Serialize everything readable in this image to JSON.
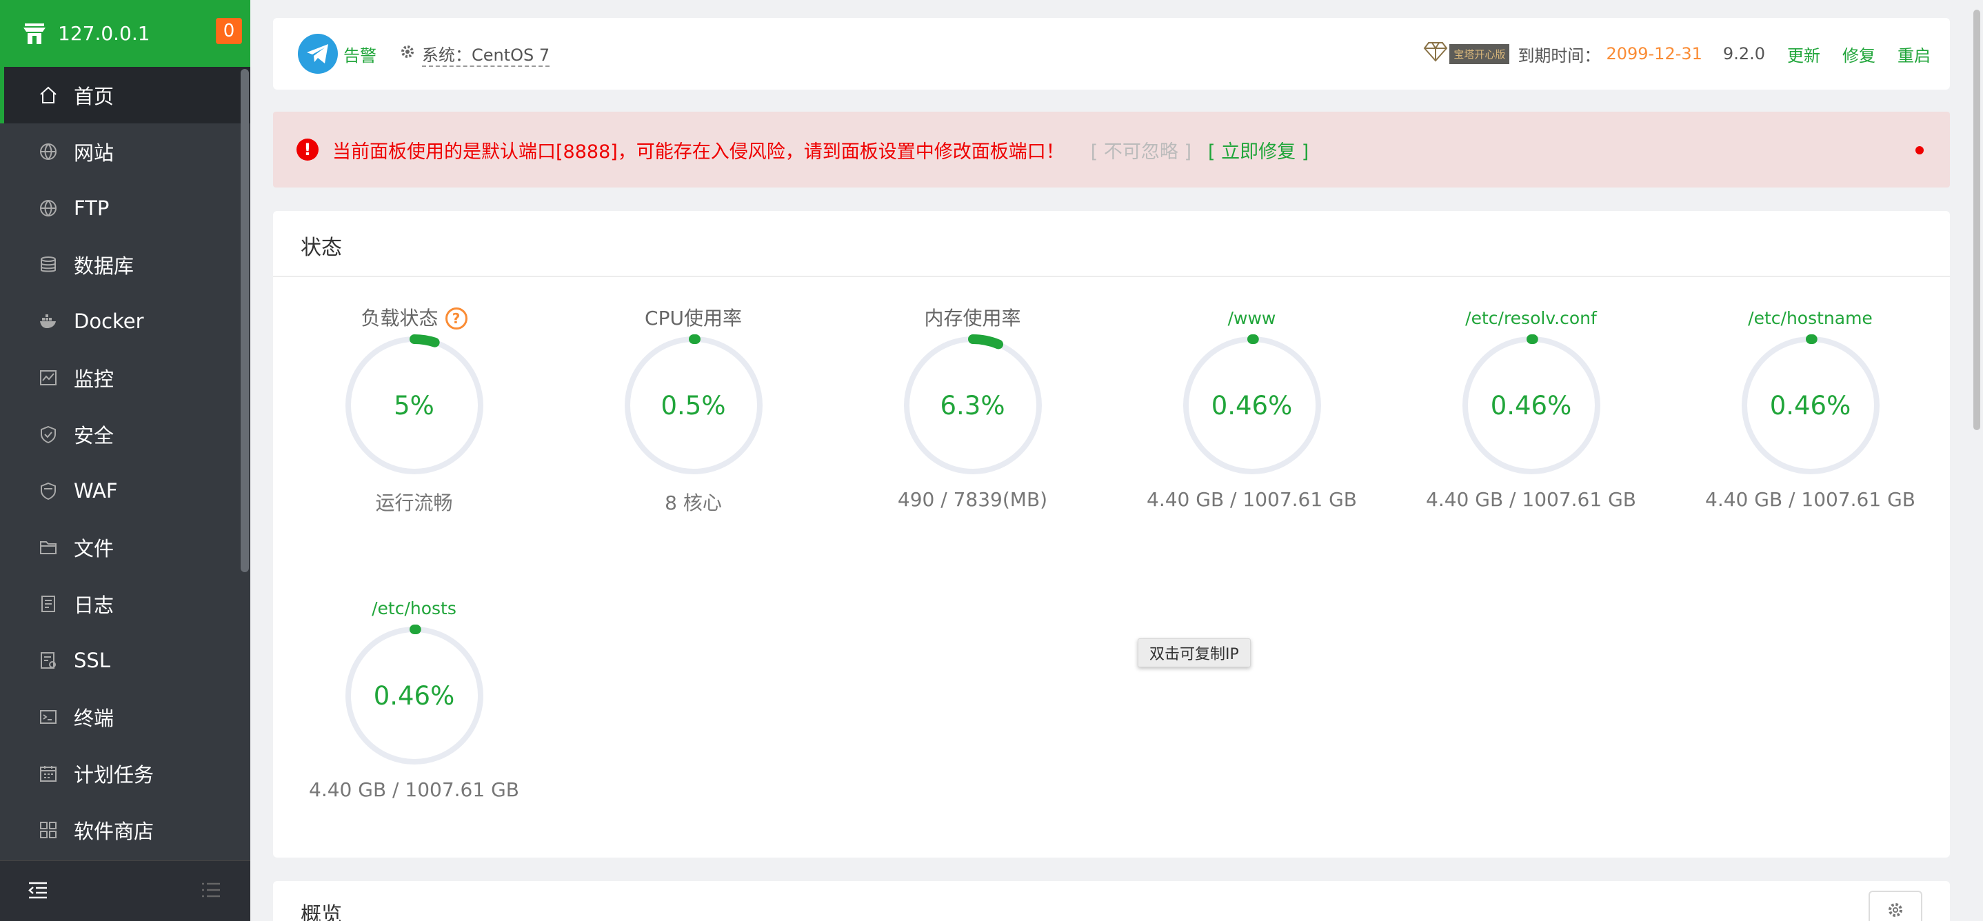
{
  "sidebar": {
    "host": "127.0.0.1",
    "badge": "0",
    "items": [
      {
        "label": "首页",
        "icon": "home-icon"
      },
      {
        "label": "网站",
        "icon": "globe-icon"
      },
      {
        "label": "FTP",
        "icon": "ftp-globe-icon"
      },
      {
        "label": "数据库",
        "icon": "database-icon"
      },
      {
        "label": "Docker",
        "icon": "docker-icon"
      },
      {
        "label": "监控",
        "icon": "monitor-icon"
      },
      {
        "label": "安全",
        "icon": "shield-icon"
      },
      {
        "label": "WAF",
        "icon": "waf-shield-icon"
      },
      {
        "label": "文件",
        "icon": "folder-icon"
      },
      {
        "label": "日志",
        "icon": "log-icon"
      },
      {
        "label": "SSL",
        "icon": "ssl-icon"
      },
      {
        "label": "终端",
        "icon": "terminal-icon"
      },
      {
        "label": "计划任务",
        "icon": "calendar-icon"
      },
      {
        "label": "软件商店",
        "icon": "apps-icon"
      }
    ]
  },
  "header": {
    "alarm": "告警",
    "system": "系统：CentOS 7",
    "ltd": "宝塔开心版",
    "expire_label": "到期时间：",
    "expire_date": "2099-12-31",
    "version": "9.2.0",
    "update": "更新",
    "repair": "修复",
    "restart": "重启"
  },
  "alert": {
    "text": "当前面板使用的是默认端口[8888]，可能存在入侵风险，请到面板设置中修改面板端口！",
    "ignore": "[ 不可忽略 ]",
    "fix": "[ 立即修复 ]"
  },
  "status": {
    "title": "状态",
    "gauges": [
      {
        "label": "负载状态",
        "value": "5%",
        "pct": 5,
        "sub": "运行流畅",
        "disk": false
      },
      {
        "label": "CPU使用率",
        "value": "0.5%",
        "pct": 0.5,
        "sub": "8 核心",
        "disk": false
      },
      {
        "label": "内存使用率",
        "value": "6.3%",
        "pct": 6.3,
        "sub": "490 / 7839(MB)",
        "disk": false
      },
      {
        "label": "/www",
        "value": "0.46%",
        "pct": 0.46,
        "sub": "4.40 GB / 1007.61 GB",
        "disk": true
      },
      {
        "label": "/etc/resolv.conf",
        "value": "0.46%",
        "pct": 0.46,
        "sub": "4.40 GB / 1007.61 GB",
        "disk": true
      },
      {
        "label": "/etc/hostname",
        "value": "0.46%",
        "pct": 0.46,
        "sub": "4.40 GB / 1007.61 GB",
        "disk": true
      },
      {
        "label": "/etc/hosts",
        "value": "0.46%",
        "pct": 0.46,
        "sub": "4.40 GB / 1007.61 GB",
        "disk": true
      }
    ]
  },
  "tooltip": "双击可复制IP",
  "overview": {
    "title": "概览"
  },
  "colors": {
    "brand": "#20a53a",
    "sidebar": "#363a40",
    "danger": "#ee0000",
    "warning": "#fa8c35"
  }
}
